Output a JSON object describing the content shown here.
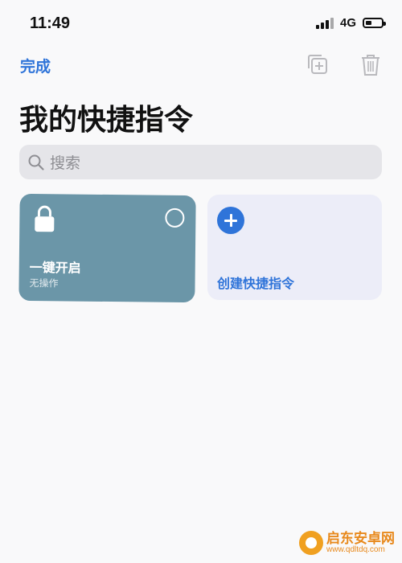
{
  "status_bar": {
    "time": "11:49",
    "network": "4G",
    "battery_level": 0.4,
    "signal_icon": "signal-bars-icon"
  },
  "nav": {
    "done_label": "完成",
    "duplicate_icon": "duplicate-icon",
    "trash_icon": "trash-icon"
  },
  "page": {
    "title": "我的快捷指令"
  },
  "search": {
    "placeholder": "搜索"
  },
  "cards": [
    {
      "title": "一键开启",
      "subtitle": "无操作",
      "icon": "lock-icon",
      "color": "#6b96a8"
    },
    {
      "label": "创建快捷指令",
      "icon": "plus-circle-icon",
      "color": "#ecedf8"
    }
  ],
  "watermark": {
    "name": "启东安卓网",
    "url": "www.qdltdq.com"
  },
  "colors": {
    "accent": "#2f74d9",
    "background": "#f9f9fa",
    "search_bg": "#e5e5e9"
  }
}
